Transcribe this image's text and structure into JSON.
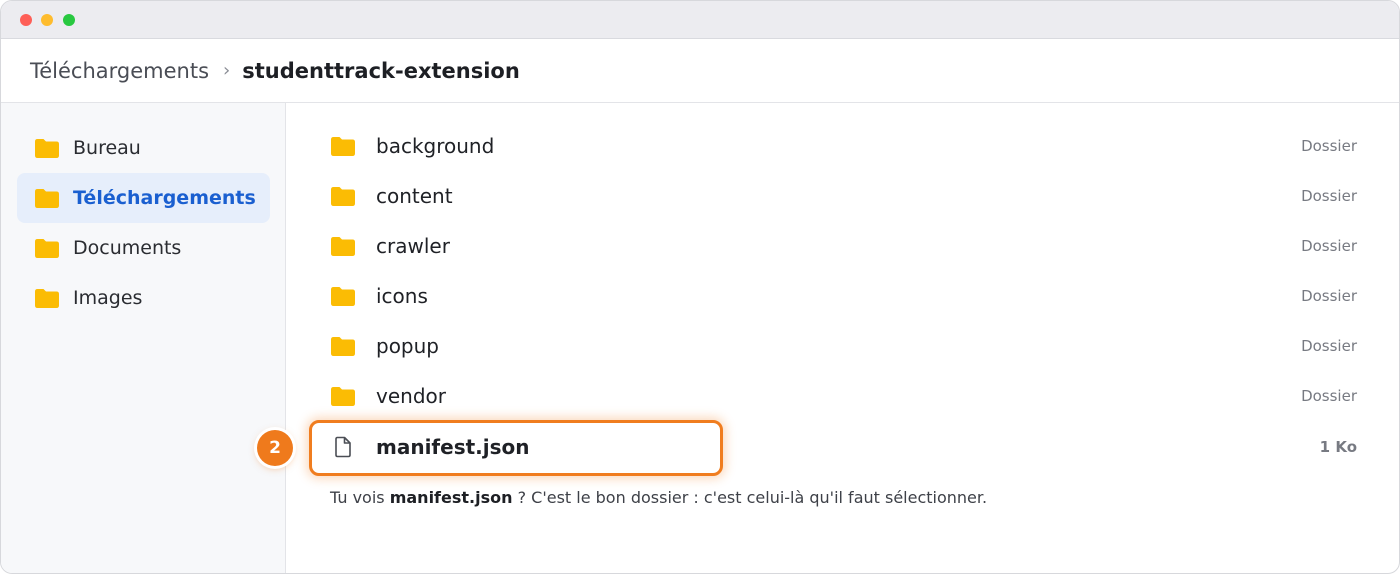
{
  "breadcrumb": {
    "parent": "Téléchargements",
    "separator": "›",
    "current": "studenttrack-extension"
  },
  "sidebar": {
    "items": [
      {
        "label": "Bureau",
        "icon": "folder-icon",
        "active": false
      },
      {
        "label": "Téléchargements",
        "icon": "folder-icon",
        "active": true
      },
      {
        "label": "Documents",
        "icon": "folder-icon",
        "active": false
      },
      {
        "label": "Images",
        "icon": "folder-icon",
        "active": false
      }
    ]
  },
  "files": {
    "folders": [
      {
        "name": "background",
        "kind": "Dossier"
      },
      {
        "name": "content",
        "kind": "Dossier"
      },
      {
        "name": "crawler",
        "kind": "Dossier"
      },
      {
        "name": "icons",
        "kind": "Dossier"
      },
      {
        "name": "popup",
        "kind": "Dossier"
      },
      {
        "name": "vendor",
        "kind": "Dossier"
      }
    ],
    "highlighted_file": {
      "name": "manifest.json",
      "size": "1 Ko",
      "icon": "file-icon"
    }
  },
  "step_badge": "2",
  "hint": {
    "before": "Tu vois ",
    "emphasis": "manifest.json",
    "after": " ? C'est le bon dossier : c'est celui-là qu'il faut sélectionner."
  },
  "colors": {
    "folder": "#fbbc04",
    "accent": "#1a5fd0",
    "highlight": "#f07d1f"
  }
}
